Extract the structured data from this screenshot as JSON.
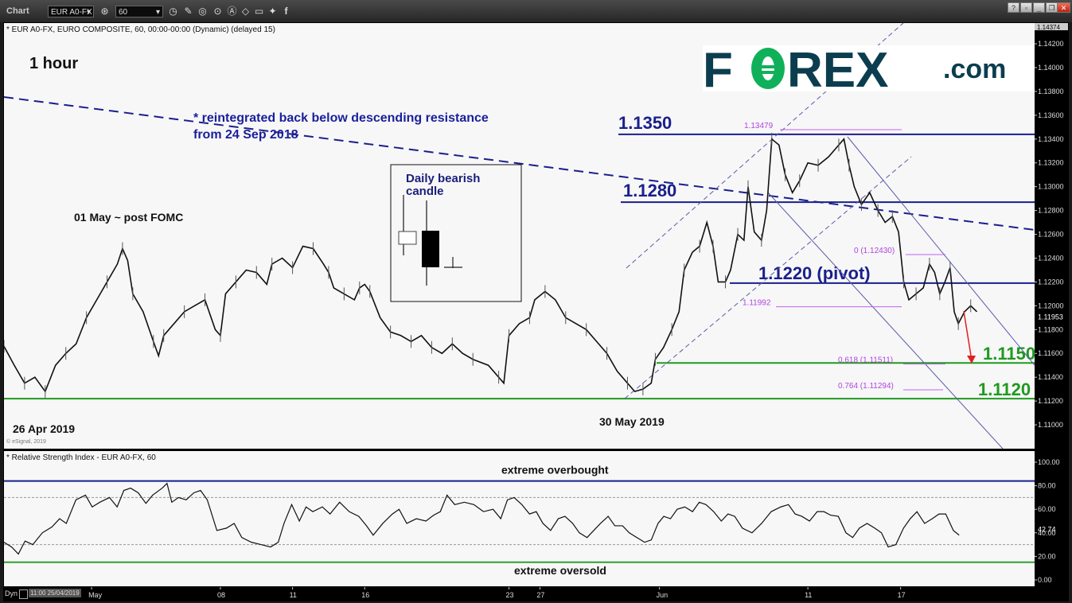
{
  "window": {
    "title": "Chart",
    "symbol": "EUR A0-FX",
    "interval": "60",
    "toolbar_icons": [
      "clock-icon",
      "pencil-icon",
      "study-icon",
      "play-icon",
      "alert-icon",
      "eraser-icon",
      "comment-icon",
      "twitter-icon",
      "facebook-icon"
    ],
    "window_buttons": [
      "help-button",
      "restore-chart-button",
      "minimize-button",
      "maximize-button",
      "close-button"
    ]
  },
  "main_pane": {
    "header": "* EUR A0-FX, EURO COMPOSITE, 60, 00:00-00:00 (Dynamic) (delayed 15)",
    "copyright": "© eSignal, 2019"
  },
  "rsi_pane": {
    "header": "* Relative Strength Index - EUR A0-FX, 60"
  },
  "axis_footer": {
    "mode": "Dyn",
    "start_time": "11:00 25/04/2019"
  },
  "logo": {
    "brand_a": "F",
    "brand_b": "REX",
    "suffix": ".com",
    "dark_color": "#0b3d4f",
    "green_color": "#10b05a"
  },
  "chart_data": [
    {
      "type": "line",
      "title": "1 hour",
      "subtype": "candlestick (hourly) EUR/USD",
      "ylim": [
        1.108,
        1.14374
      ],
      "y_ticks": [
        "1.14200",
        "1.14000",
        "1.13800",
        "1.13600",
        "1.13400",
        "1.13200",
        "1.13000",
        "1.12800",
        "1.12600",
        "1.12400",
        "1.12200",
        "1.12000",
        "1.11800",
        "1.11600",
        "1.11400",
        "1.11200",
        "1.11000"
      ],
      "y_top_label": "1.14374",
      "last_price": "1.11953",
      "x_ticks": [
        "May",
        "08",
        "11",
        "16",
        "23",
        "27",
        "Jun",
        "11",
        "17"
      ],
      "x_ticks_pos": [
        0.085,
        0.21,
        0.28,
        0.35,
        0.49,
        0.52,
        0.636,
        0.78,
        0.87
      ],
      "price_path": [
        [
          0.0,
          1.1166
        ],
        [
          0.01,
          1.115
        ],
        [
          0.02,
          1.1135
        ],
        [
          0.03,
          1.114
        ],
        [
          0.04,
          1.1128
        ],
        [
          0.05,
          1.115
        ],
        [
          0.06,
          1.116
        ],
        [
          0.07,
          1.1168
        ],
        [
          0.08,
          1.119
        ],
        [
          0.09,
          1.1205
        ],
        [
          0.1,
          1.122
        ],
        [
          0.11,
          1.1235
        ],
        [
          0.115,
          1.1248
        ],
        [
          0.12,
          1.1238
        ],
        [
          0.125,
          1.121
        ],
        [
          0.135,
          1.1195
        ],
        [
          0.145,
          1.117
        ],
        [
          0.15,
          1.1158
        ],
        [
          0.155,
          1.1175
        ],
        [
          0.165,
          1.1185
        ],
        [
          0.175,
          1.1195
        ],
        [
          0.185,
          1.12
        ],
        [
          0.195,
          1.1205
        ],
        [
          0.205,
          1.118
        ],
        [
          0.21,
          1.1175
        ],
        [
          0.215,
          1.121
        ],
        [
          0.225,
          1.122
        ],
        [
          0.235,
          1.123
        ],
        [
          0.245,
          1.1228
        ],
        [
          0.255,
          1.1218
        ],
        [
          0.26,
          1.1235
        ],
        [
          0.27,
          1.124
        ],
        [
          0.28,
          1.1232
        ],
        [
          0.29,
          1.125
        ],
        [
          0.3,
          1.1248
        ],
        [
          0.31,
          1.1235
        ],
        [
          0.315,
          1.1228
        ],
        [
          0.32,
          1.1215
        ],
        [
          0.33,
          1.121
        ],
        [
          0.34,
          1.1205
        ],
        [
          0.345,
          1.1215
        ],
        [
          0.35,
          1.1218
        ],
        [
          0.355,
          1.1212
        ],
        [
          0.365,
          1.119
        ],
        [
          0.375,
          1.1178
        ],
        [
          0.385,
          1.1175
        ],
        [
          0.395,
          1.117
        ],
        [
          0.405,
          1.1175
        ],
        [
          0.415,
          1.1165
        ],
        [
          0.425,
          1.116
        ],
        [
          0.435,
          1.1168
        ],
        [
          0.445,
          1.116
        ],
        [
          0.455,
          1.1155
        ],
        [
          0.47,
          1.115
        ],
        [
          0.48,
          1.114
        ],
        [
          0.485,
          1.1135
        ],
        [
          0.49,
          1.1175
        ],
        [
          0.5,
          1.1185
        ],
        [
          0.51,
          1.119
        ],
        [
          0.515,
          1.1205
        ],
        [
          0.525,
          1.1212
        ],
        [
          0.535,
          1.1205
        ],
        [
          0.545,
          1.119
        ],
        [
          0.555,
          1.1185
        ],
        [
          0.565,
          1.118
        ],
        [
          0.575,
          1.117
        ],
        [
          0.585,
          1.116
        ],
        [
          0.595,
          1.1145
        ],
        [
          0.605,
          1.1135
        ],
        [
          0.612,
          1.1128
        ],
        [
          0.62,
          1.113
        ],
        [
          0.628,
          1.1135
        ],
        [
          0.632,
          1.1155
        ],
        [
          0.64,
          1.1165
        ],
        [
          0.648,
          1.118
        ],
        [
          0.655,
          1.1195
        ],
        [
          0.66,
          1.123
        ],
        [
          0.668,
          1.1245
        ],
        [
          0.675,
          1.125
        ],
        [
          0.682,
          1.127
        ],
        [
          0.688,
          1.125
        ],
        [
          0.693,
          1.122
        ],
        [
          0.7,
          1.122
        ],
        [
          0.705,
          1.123
        ],
        [
          0.712,
          1.126
        ],
        [
          0.718,
          1.1255
        ],
        [
          0.722,
          1.13
        ],
        [
          0.728,
          1.1262
        ],
        [
          0.735,
          1.1255
        ],
        [
          0.74,
          1.128
        ],
        [
          0.745,
          1.134
        ],
        [
          0.752,
          1.1335
        ],
        [
          0.758,
          1.131
        ],
        [
          0.765,
          1.1295
        ],
        [
          0.772,
          1.1305
        ],
        [
          0.78,
          1.132
        ],
        [
          0.79,
          1.1318
        ],
        [
          0.8,
          1.1325
        ],
        [
          0.81,
          1.1335
        ],
        [
          0.815,
          1.134
        ],
        [
          0.82,
          1.1318
        ],
        [
          0.825,
          1.13
        ],
        [
          0.832,
          1.1285
        ],
        [
          0.84,
          1.1295
        ],
        [
          0.848,
          1.128
        ],
        [
          0.855,
          1.127
        ],
        [
          0.862,
          1.1275
        ],
        [
          0.868,
          1.1262
        ],
        [
          0.873,
          1.122
        ],
        [
          0.878,
          1.1205
        ],
        [
          0.885,
          1.121
        ],
        [
          0.892,
          1.1215
        ],
        [
          0.898,
          1.1235
        ],
        [
          0.903,
          1.1228
        ],
        [
          0.908,
          1.121
        ],
        [
          0.913,
          1.122
        ],
        [
          0.918,
          1.1232
        ],
        [
          0.922,
          1.1195
        ],
        [
          0.926,
          1.1185
        ],
        [
          0.932,
          1.1195
        ],
        [
          0.938,
          1.12
        ],
        [
          0.944,
          1.1195
        ]
      ],
      "levels": [
        {
          "label": "1.1350",
          "value": 1.1344,
          "color": "#1a1f8c"
        },
        {
          "label": "1.1280",
          "value": 1.1287,
          "color": "#1a1f8c"
        },
        {
          "label": "1.1220 (pivot)",
          "value": 1.1219,
          "color": "#1a1f8c"
        },
        {
          "label": "1.1150",
          "value": 1.1152,
          "color": "#1f9a1f"
        },
        {
          "label": "1.1120",
          "value": 1.1122,
          "color": "#1f9a1f"
        }
      ],
      "fib_labels": [
        {
          "text": "1.13479",
          "value": 1.13479
        },
        {
          "text": "0 (1.12430)",
          "value": 1.1243
        },
        {
          "text": "1.11992",
          "value": 1.11992
        },
        {
          "text": "0.618 (1.11511)",
          "value": 1.11511
        },
        {
          "text": "0.764 (1.11294)",
          "value": 1.11294
        }
      ],
      "annotations": [
        {
          "text": "1 hour"
        },
        {
          "text": "* reintegrated back below descending resistance"
        },
        {
          "text": "from 24 Sep 2018"
        },
        {
          "text": "01 May ~ post FOMC"
        },
        {
          "text": "26 Apr 2019"
        },
        {
          "text": "30 May 2019"
        },
        {
          "text": "Daily bearish"
        },
        {
          "text": "candle"
        }
      ],
      "forecast_arrow": {
        "from": 1.1195,
        "to": 1.1155,
        "color": "#e02020"
      }
    },
    {
      "type": "line",
      "title": "Relative Strength Index - EUR A0-FX, 60",
      "ylim": [
        0,
        100
      ],
      "y_ticks": [
        "100.00",
        "80.00",
        "60.00",
        "40.00",
        "20.00",
        "0.00"
      ],
      "last_value": "42.74",
      "guides": [
        70,
        30
      ],
      "levels": [
        {
          "label": "extreme overbought",
          "value": 84,
          "color": "#1a1f8c"
        },
        {
          "label": "extreme oversold",
          "value": 15,
          "color": "#2ea02e"
        }
      ],
      "rsi_path": [
        [
          0.0,
          32
        ],
        [
          0.008,
          28
        ],
        [
          0.015,
          22
        ],
        [
          0.022,
          33
        ],
        [
          0.03,
          30
        ],
        [
          0.04,
          40
        ],
        [
          0.05,
          45
        ],
        [
          0.058,
          52
        ],
        [
          0.065,
          48
        ],
        [
          0.075,
          68
        ],
        [
          0.085,
          72
        ],
        [
          0.092,
          62
        ],
        [
          0.1,
          66
        ],
        [
          0.11,
          70
        ],
        [
          0.118,
          62
        ],
        [
          0.125,
          76
        ],
        [
          0.132,
          78
        ],
        [
          0.14,
          74
        ],
        [
          0.148,
          65
        ],
        [
          0.155,
          72
        ],
        [
          0.165,
          78
        ],
        [
          0.17,
          82
        ],
        [
          0.175,
          66
        ],
        [
          0.182,
          70
        ],
        [
          0.19,
          68
        ],
        [
          0.198,
          74
        ],
        [
          0.205,
          76
        ],
        [
          0.212,
          68
        ],
        [
          0.222,
          42
        ],
        [
          0.232,
          44
        ],
        [
          0.24,
          48
        ],
        [
          0.248,
          36
        ],
        [
          0.258,
          32
        ],
        [
          0.268,
          30
        ],
        [
          0.278,
          28
        ],
        [
          0.286,
          32
        ],
        [
          0.292,
          48
        ],
        [
          0.3,
          64
        ],
        [
          0.308,
          50
        ],
        [
          0.315,
          62
        ],
        [
          0.322,
          58
        ],
        [
          0.332,
          62
        ],
        [
          0.34,
          56
        ],
        [
          0.35,
          66
        ],
        [
          0.36,
          58
        ],
        [
          0.37,
          54
        ],
        [
          0.378,
          46
        ],
        [
          0.385,
          38
        ],
        [
          0.395,
          48
        ],
        [
          0.405,
          56
        ],
        [
          0.412,
          60
        ],
        [
          0.42,
          48
        ],
        [
          0.43,
          52
        ],
        [
          0.44,
          50
        ],
        [
          0.448,
          55
        ],
        [
          0.455,
          58
        ],
        [
          0.462,
          72
        ],
        [
          0.47,
          64
        ],
        [
          0.48,
          66
        ],
        [
          0.49,
          64
        ],
        [
          0.5,
          58
        ],
        [
          0.51,
          60
        ],
        [
          0.518,
          52
        ],
        [
          0.525,
          68
        ],
        [
          0.532,
          70
        ],
        [
          0.54,
          64
        ],
        [
          0.548,
          56
        ],
        [
          0.555,
          58
        ],
        [
          0.562,
          48
        ],
        [
          0.57,
          42
        ],
        [
          0.578,
          52
        ],
        [
          0.585,
          54
        ],
        [
          0.593,
          48
        ],
        [
          0.6,
          40
        ],
        [
          0.608,
          36
        ],
        [
          0.615,
          42
        ],
        [
          0.622,
          48
        ],
        [
          0.63,
          54
        ],
        [
          0.637,
          46
        ],
        [
          0.645,
          46
        ],
        [
          0.652,
          40
        ],
        [
          0.66,
          36
        ],
        [
          0.668,
          32
        ],
        [
          0.675,
          34
        ],
        [
          0.682,
          48
        ],
        [
          0.688,
          54
        ],
        [
          0.695,
          52
        ],
        [
          0.702,
          60
        ],
        [
          0.71,
          62
        ],
        [
          0.718,
          58
        ],
        [
          0.725,
          66
        ],
        [
          0.732,
          64
        ],
        [
          0.74,
          58
        ],
        [
          0.748,
          50
        ],
        [
          0.755,
          56
        ],
        [
          0.762,
          54
        ],
        [
          0.77,
          44
        ],
        [
          0.78,
          40
        ],
        [
          0.79,
          48
        ],
        [
          0.8,
          58
        ],
        [
          0.81,
          62
        ],
        [
          0.818,
          64
        ],
        [
          0.825,
          56
        ],
        [
          0.832,
          54
        ],
        [
          0.84,
          50
        ],
        [
          0.848,
          58
        ],
        [
          0.855,
          58
        ],
        [
          0.862,
          55
        ],
        [
          0.87,
          54
        ],
        [
          0.878,
          40
        ],
        [
          0.885,
          36
        ],
        [
          0.892,
          44
        ],
        [
          0.9,
          48
        ],
        [
          0.908,
          44
        ],
        [
          0.915,
          40
        ],
        [
          0.922,
          28
        ],
        [
          0.93,
          30
        ],
        [
          0.938,
          44
        ],
        [
          0.945,
          52
        ],
        [
          0.952,
          58
        ],
        [
          0.96,
          48
        ],
        [
          0.968,
          52
        ],
        [
          0.975,
          56
        ],
        [
          0.982,
          56
        ],
        [
          0.99,
          42
        ],
        [
          0.996,
          38
        ]
      ]
    }
  ]
}
